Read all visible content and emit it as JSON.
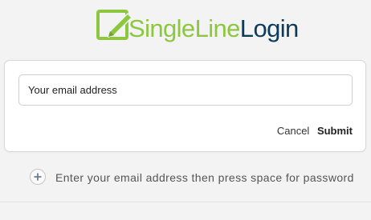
{
  "brand": {
    "name_part1": "SingleLine",
    "name_part2": "Login",
    "icon": "pencil-square-icon",
    "colors": {
      "green": "#8dc63f",
      "navy": "#0d3b5a"
    }
  },
  "form": {
    "email_placeholder": "Your email address",
    "email_value": "",
    "cancel_label": "Cancel",
    "submit_label": "Submit"
  },
  "hint": {
    "icon": "plus-icon",
    "text": "Enter your email address then press space for password"
  }
}
